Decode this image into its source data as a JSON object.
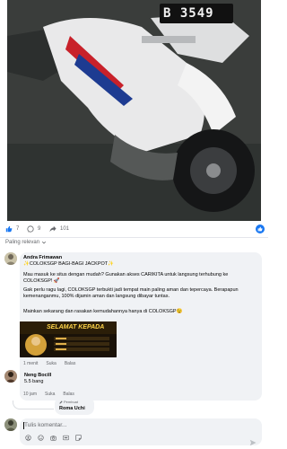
{
  "post": {
    "plate_text": "B 3549",
    "reactions": {
      "like_count": "7",
      "comment_count": "9",
      "share_count": "101"
    }
  },
  "sort": {
    "label": "Paling relevan"
  },
  "comments": [
    {
      "author": "Andra Frimawan",
      "title": "✨COLOKSGP BAGI-BAGI JACKPOT✨",
      "paragraphs": [
        "Mau masuk ke situs dengan mudah? Gunakan akses CARIKITA untuk langsung terhubung ke COLOKSGP! 🚀",
        "Gak perlu ragu lagi, COLOKSGP terbukti jadi tempat main paling aman dan tepercaya. Berapapun kemenanganmu, 100% dijamin aman dan langsung dibayar tuntas.",
        "Mainkan sekarang dan rasakan kemudahannya hanya di COLOKSGP😉"
      ],
      "promo_text": "SELAMAT KEPADA",
      "time": "1 menit",
      "like": "Suka",
      "reply": "Balas"
    },
    {
      "author": "Neng Bocill",
      "text": "5.5 bang",
      "time": "10 jam",
      "like": "Suka",
      "reply": "Balas"
    },
    {
      "badge": "Pembuat",
      "author": "Roma Uchi"
    }
  ],
  "composer": {
    "placeholder": "Tulis komentar..."
  },
  "colors": {
    "accent": "#1877f2",
    "bubble": "#f0f2f5",
    "muted": "#65676b"
  }
}
